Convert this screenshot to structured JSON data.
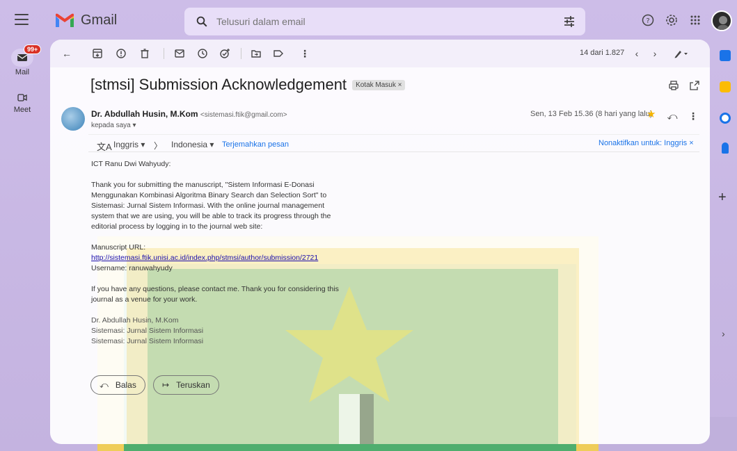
{
  "app": {
    "name": "Gmail"
  },
  "search": {
    "placeholder": "Telusuri dalam email"
  },
  "rail": {
    "mail_label": "Mail",
    "mail_badge": "99+",
    "meet_label": "Meet"
  },
  "toolbar": {
    "pager": "14 dari 1.827"
  },
  "email": {
    "subject": "[stmsi] Submission Acknowledgement",
    "label_chip": "Kotak Masuk ×",
    "sender_name": "Dr. Abdullah Husin, M.Kom",
    "sender_email": "<sistemasi.ftik@gmail.com>",
    "to": "kepada saya ▾",
    "date": "Sen, 13 Feb 15.36 (8 hari yang lalu)"
  },
  "translate": {
    "from": "Inggris ▾",
    "arrow": "〉",
    "to": "Indonesia ▾",
    "action": "Terjemahkan pesan",
    "disable": "Nonaktifkan untuk: Inggris ×"
  },
  "body": {
    "greeting": "ICT Ranu Dwi Wahyudy:",
    "p1": "Thank you for submitting the manuscript, \"Sistem Informasi E-Donasi Menggunakan Kombinasi Algoritma Binary Search dan Selection Sort\" to Sistemasi: Jurnal Sistem Informasi. With the online journal management system that we are using, you will be able to track its progress through the editorial process by logging in to the journal web site:",
    "url_label": "Manuscript URL:",
    "url": "http://sistemasi.ftik.unisi.ac.id/index.php/stmsi/author/submission/2721",
    "username_label": "Username:",
    "username": "ranuwahyudy",
    "p3": "If you have any questions, please contact me. Thank you for considering this journal as a venue for your work.",
    "sig1": "Dr. Abdullah Husin, M.Kom",
    "sig2": "Sistemasi: Jurnal Sistem Informasi",
    "sig3": "Sistemasi: Jurnal Sistem Informasi"
  },
  "actions": {
    "reply": "Balas",
    "forward": "Teruskan"
  },
  "colors": {
    "accent": "#1a73e8",
    "star": "#f4b400",
    "badge": "#d93025"
  }
}
